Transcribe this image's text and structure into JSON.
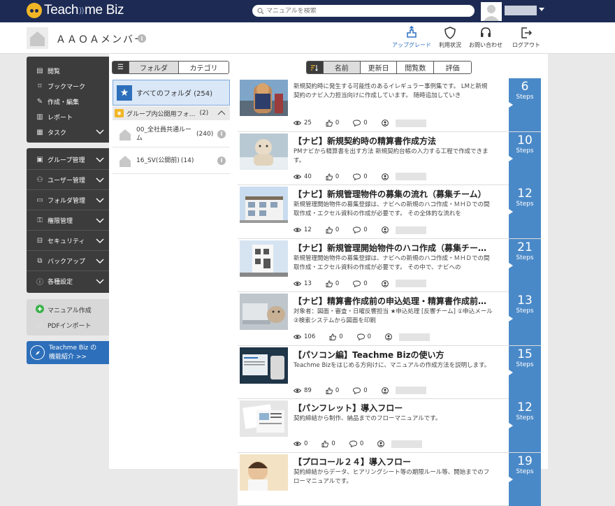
{
  "app": {
    "logo_text_1": "Teach",
    "logo_text_2": "me Biz",
    "logo_waves": "))"
  },
  "search": {
    "placeholder": "マニュアルを検索"
  },
  "header": {
    "group_title": "ＡＡＯＡメンバー",
    "buttons": [
      {
        "label": "アップグレード",
        "icon": "upgrade-icon"
      },
      {
        "label": "利用状況",
        "icon": "shield-icon"
      },
      {
        "label": "お問い合わせ",
        "icon": "headset-icon"
      },
      {
        "label": "ログアウト",
        "icon": "logout-icon"
      }
    ]
  },
  "sidebar": {
    "main_items": [
      {
        "label": "閲覧",
        "icon": "book-icon"
      },
      {
        "label": "ブックマーク",
        "icon": "bookmark-icon"
      },
      {
        "label": "作成・編集",
        "icon": "pencil-icon"
      },
      {
        "label": "レポート",
        "icon": "report-icon"
      },
      {
        "label": "タスク",
        "icon": "calendar-icon"
      }
    ],
    "admin_items": [
      {
        "label": "グループ管理",
        "icon": "group-icon"
      },
      {
        "label": "ユーザー管理",
        "icon": "users-icon"
      },
      {
        "label": "フォルダ管理",
        "icon": "folder-icon"
      },
      {
        "label": "権限管理",
        "icon": "key-icon"
      },
      {
        "label": "セキュリティ",
        "icon": "lock-icon"
      },
      {
        "label": "バックアップ",
        "icon": "backup-icon"
      },
      {
        "label": "各種設定",
        "icon": "info-icon"
      }
    ],
    "create_label": "マニュアル作成",
    "pdf_label": "PDFインポート",
    "promo_line1": "Teachme Biz の",
    "promo_line2": "機能紹介 >>"
  },
  "folders": {
    "tabs": [
      "フォルダ",
      "カテゴリ"
    ],
    "all_label": "すべてのフォルダ (254)",
    "group_label": "グループ内公開用フォ…",
    "group_count": "(2)",
    "items": [
      {
        "name": "00_全社員共通ルーム",
        "count": "(240)"
      },
      {
        "name": "16_SV(公開前)",
        "count": "(14)"
      }
    ]
  },
  "sort": {
    "options": [
      "名前",
      "更新日",
      "閲覧数",
      "評価"
    ]
  },
  "cards": [
    {
      "title": "",
      "desc": "新規契約時に発生する可能性のあるイレギュラー事例集です。 LMと新規契約のナビ入力担当向けに作成しています。 随時追加していき",
      "views": "25",
      "likes": "0",
      "comments": "0",
      "steps": "6"
    },
    {
      "title": "【ナビ】新規契約時の精算書作成方法",
      "desc": "PMナビから精算書を出す方法 新規契約台帳の入力する工程で作成できます。",
      "views": "40",
      "likes": "0",
      "comments": "0",
      "steps": "10"
    },
    {
      "title": "【ナビ】新規管理物件の募集の流れ（募集チーム）",
      "desc": "新規管理開始物件の募集登録は、ナビへの新規のハコ作成・ＭＨＤでの間取作成・エクセル資料の作成が必要です。 その全体的な流れを",
      "views": "12",
      "likes": "0",
      "comments": "0",
      "steps": "12"
    },
    {
      "title": "【ナビ】新規管理開始物件のハコ作成（募集チー…",
      "desc": "新規管理開始物件の募集登録は、ナビへの新規のハコ作成・ＭＨＤでの間取作成・エクセル資料の作成が必要です。 その中で、ナビへの",
      "views": "13",
      "likes": "0",
      "comments": "0",
      "steps": "21"
    },
    {
      "title": "【ナビ】精算書作成前の申込処理・精算書作成前…",
      "desc": "対象者：図面・審査・日曜反響担当 ★申込処理 [反響チーム] ①申込メール　　　　　②検索システムから図面を印刷",
      "views": "106",
      "likes": "0",
      "comments": "0",
      "steps": "13"
    },
    {
      "title": "【パソコン編】Teachme Bizの使い方",
      "desc": "Teachme Bizをはじめる方向けに、マニュアルの作成方法を説明します。",
      "views": "89",
      "likes": "0",
      "comments": "0",
      "steps": "15"
    },
    {
      "title": "【パンフレット】導入フロー",
      "desc": "契約締結から制作、納品までのフローマニュアルです。",
      "views": "0",
      "likes": "0",
      "comments": "0",
      "steps": "12"
    },
    {
      "title": "【プロコール２４】導入フロー",
      "desc": "契約締結からデータ、ヒアリングシート等の期限ルール等、開始までのフローマニュアルです。",
      "views": "",
      "likes": "",
      "comments": "",
      "steps": "19"
    }
  ],
  "steps_label": "Steps",
  "colors": {
    "topbar": "#1d2b54",
    "accent": "#2d6fba",
    "steps": "#4a89c8",
    "logo_yellow": "#f1b625"
  }
}
